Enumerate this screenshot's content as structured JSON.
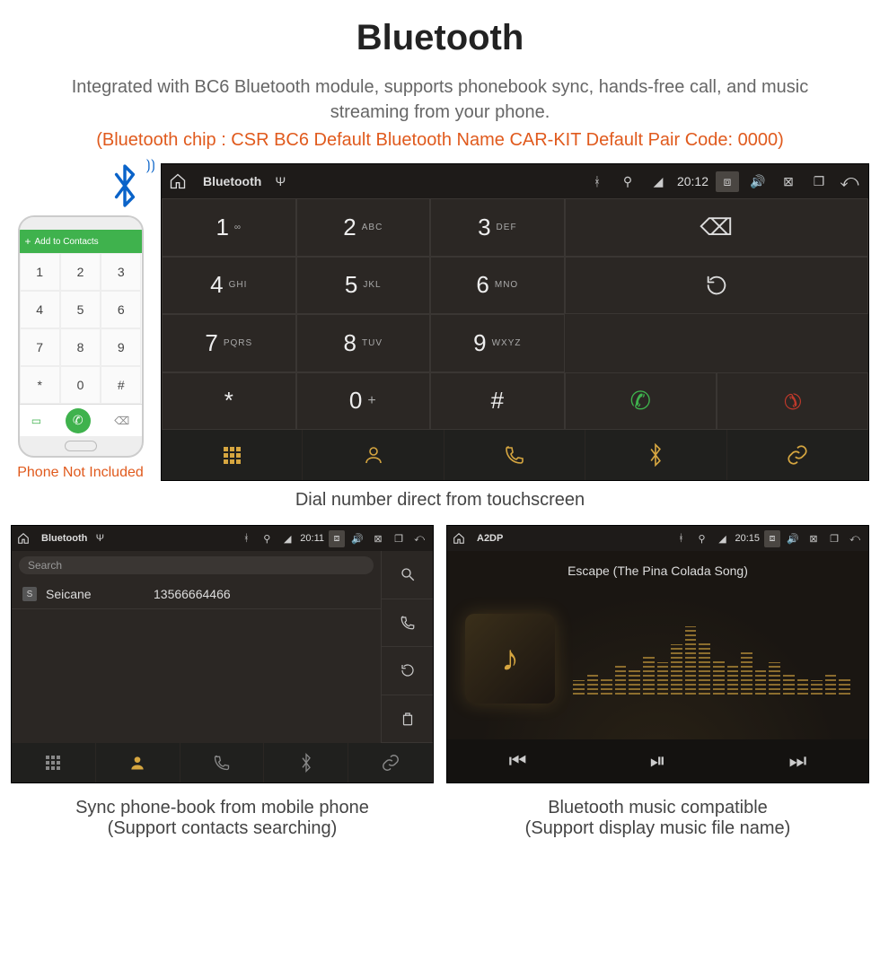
{
  "header": {
    "title": "Bluetooth",
    "description": "Integrated with BC6 Bluetooth module, supports phonebook sync, hands-free call, and music streaming from your phone.",
    "specs": "(Bluetooth chip : CSR BC6     Default Bluetooth Name CAR-KIT     Default Pair Code: 0000)"
  },
  "phone": {
    "add_contacts_label": "Add to Contacts",
    "caption": "Phone Not Included",
    "keys": [
      "1",
      "2",
      "3",
      "4",
      "5",
      "6",
      "7",
      "8",
      "9",
      "*",
      "0",
      "#"
    ]
  },
  "dialer": {
    "statusbar": {
      "title": "Bluetooth",
      "time": "20:12"
    },
    "keys": [
      {
        "num": "1",
        "letters": "∞"
      },
      {
        "num": "2",
        "letters": "ABC"
      },
      {
        "num": "3",
        "letters": "DEF"
      },
      {
        "num": "4",
        "letters": "GHI"
      },
      {
        "num": "5",
        "letters": "JKL"
      },
      {
        "num": "6",
        "letters": "MNO"
      },
      {
        "num": "7",
        "letters": "PQRS"
      },
      {
        "num": "8",
        "letters": "TUV"
      },
      {
        "num": "9",
        "letters": "WXYZ"
      },
      {
        "num": "*",
        "letters": ""
      },
      {
        "num": "0",
        "letters": "+"
      },
      {
        "num": "#",
        "letters": ""
      }
    ],
    "caption": "Dial number direct from touchscreen"
  },
  "contacts": {
    "statusbar": {
      "title": "Bluetooth",
      "time": "20:11"
    },
    "search_placeholder": "Search",
    "item": {
      "initial": "S",
      "name": "Seicane",
      "number": "13566664466"
    },
    "caption_line1": "Sync phone-book from mobile phone",
    "caption_line2": "(Support contacts searching)"
  },
  "music": {
    "statusbar": {
      "title": "A2DP",
      "time": "20:15"
    },
    "song_title": "Escape (The Pina Colada Song)",
    "caption_line1": "Bluetooth music compatible",
    "caption_line2": "(Support display music file name)"
  }
}
